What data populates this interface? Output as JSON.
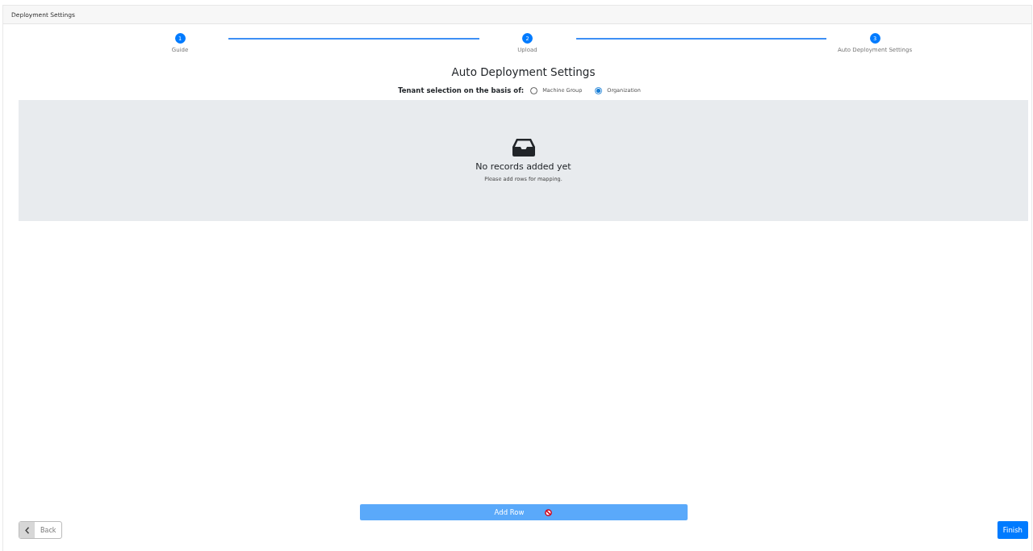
{
  "header": {
    "title": "Deployment Settings"
  },
  "steps": [
    {
      "number": "1",
      "label": "Guide",
      "completed": true
    },
    {
      "number": "2",
      "label": "Upload",
      "completed": true
    },
    {
      "number": "3",
      "label": "Auto Deployment Settings",
      "completed": true
    }
  ],
  "heading": "Auto Deployment Settings",
  "tenant_selection": {
    "label": "Tenant selection on the basis of:",
    "options": [
      {
        "label": "Machine Group",
        "selected": false
      },
      {
        "label": "Organization",
        "selected": true
      }
    ]
  },
  "empty_state": {
    "title": "No records added yet",
    "message": "Please add rows for mapping."
  },
  "add_row_button": {
    "label": "Add Row",
    "disabled": true
  },
  "back_button": {
    "label": "Back"
  },
  "finish_button": {
    "label": "Finish"
  }
}
